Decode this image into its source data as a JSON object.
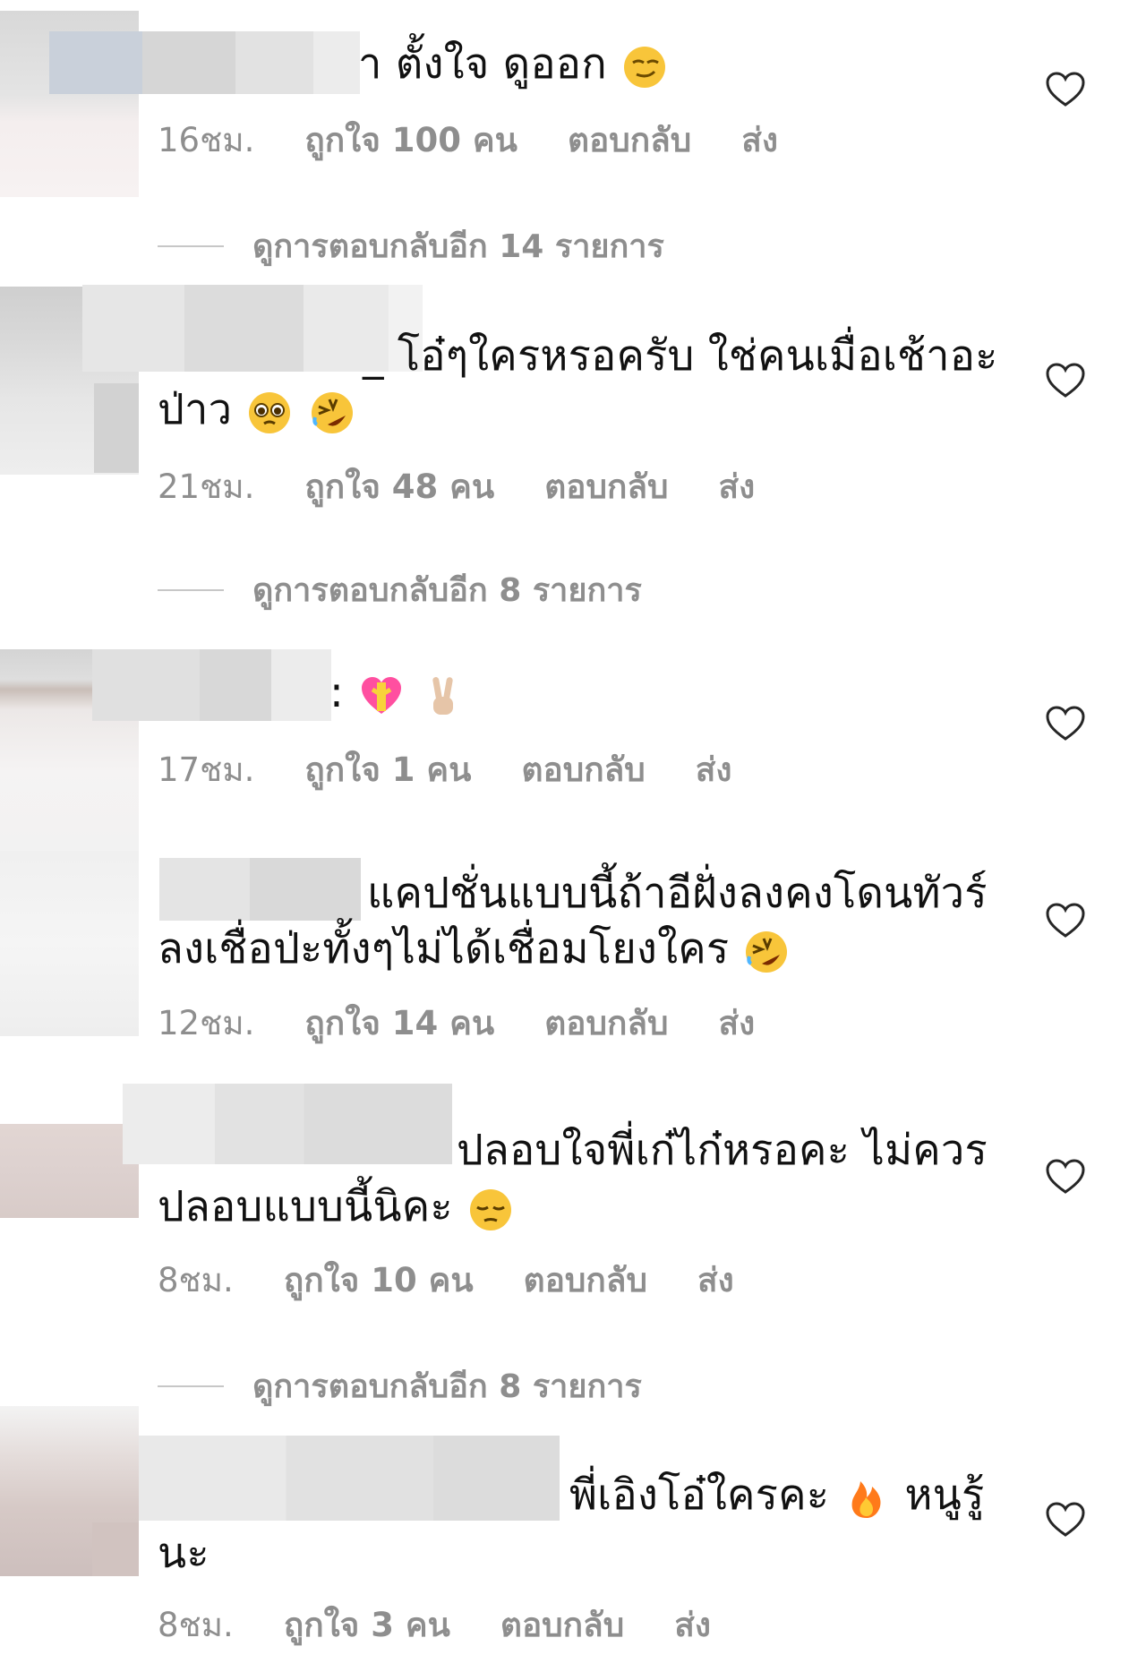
{
  "comments": [
    {
      "text_lines": [
        "า ตั้งใจ ดูออก"
      ],
      "emojis": [
        "smirk-face"
      ],
      "time": "16ชม.",
      "likes": "ถูกใจ 100 คน",
      "reply": "ตอบกลับ",
      "send": "ส่ง"
    },
    {
      "text_lines": [
        "_ โอ๋ๆใครหรอครับ ใช่คนเมื่อเช้าอะ",
        "ป่าว"
      ],
      "emojis": [
        "pleading-face",
        "rolling-laughing-face"
      ],
      "time": "21ชม.",
      "likes": "ถูกใจ 48 คน",
      "reply": "ตอบกลับ",
      "send": "ส่ง"
    },
    {
      "text_lines": [
        ":"
      ],
      "emojis": [
        "heart-with-ribbon",
        "victory-hand"
      ],
      "time": "17ชม.",
      "likes": "ถูกใจ 1 คน",
      "reply": "ตอบกลับ",
      "send": "ส่ง"
    },
    {
      "text_lines": [
        "แคปชั่นแบบนี้ถ้าอีฝั่งลงคงโดนทัวร์",
        "ลงเชื่อป่ะทั้งๆไม่ได้เชื่อมโยงใคร"
      ],
      "emojis": [
        "rolling-laughing-face"
      ],
      "time": "12ชม.",
      "likes": "ถูกใจ 14 คน",
      "reply": "ตอบกลับ",
      "send": "ส่ง"
    },
    {
      "text_lines": [
        "ปลอบใจพี่เก๋ไก๋หรอคะ ไม่ควร",
        "ปลอบแบบนี้นิคะ"
      ],
      "emojis": [
        "pensive-face"
      ],
      "time": "8ชม.",
      "likes": "ถูกใจ 10 คน",
      "reply": "ตอบกลับ",
      "send": "ส่ง"
    },
    {
      "text_lines": [
        "พี่เอิงโอ๋ใครคะ",
        "หนูรู้",
        "นะ"
      ],
      "emojis": [
        "fire"
      ],
      "time": "8ชม.",
      "likes": "ถูกใจ 3 คน",
      "reply": "ตอบกลับ",
      "send": "ส่ง"
    }
  ],
  "view_replies": [
    "ดูการตอบกลับอีก 14 รายการ",
    "ดูการตอบกลับอีก 8 รายการ",
    "ดูการตอบกลับอีก 8 รายการ"
  ],
  "icons": {
    "like": "heart-outline-icon"
  },
  "colors": {
    "meta": "#8e8e8e",
    "text": "#111111",
    "rule": "#c7c7c7"
  }
}
